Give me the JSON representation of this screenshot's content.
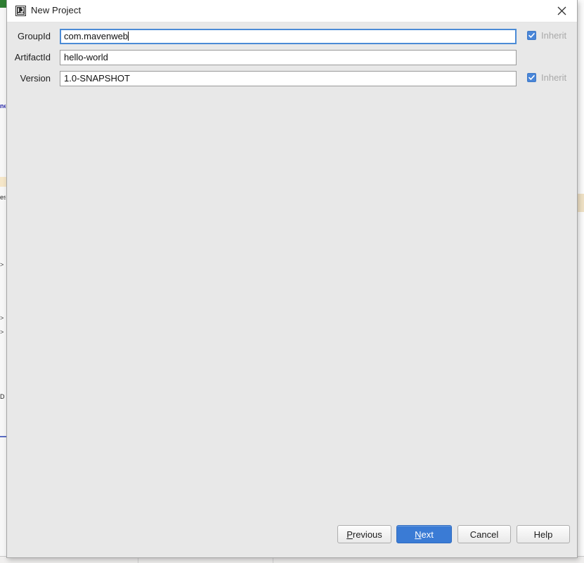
{
  "window": {
    "title": "New Project",
    "icon": "intellij-idea-icon",
    "close_icon": "close-icon"
  },
  "form": {
    "rows": [
      {
        "label": "GroupId",
        "value": "com.mavenweb",
        "focused": true,
        "caret": true,
        "inherit": {
          "label": "Inherit",
          "checked": true,
          "visible": true
        }
      },
      {
        "label": "ArtifactId",
        "value": "hello-world",
        "focused": false,
        "caret": false,
        "inherit": {
          "label": "",
          "checked": false,
          "visible": false
        }
      },
      {
        "label": "Version",
        "value": "1.0-SNAPSHOT",
        "focused": false,
        "caret": false,
        "inherit": {
          "label": "Inherit",
          "checked": true,
          "visible": true
        }
      }
    ]
  },
  "buttons": {
    "previous": {
      "label": "Previous",
      "mnemonic": "P",
      "rest": "revious",
      "primary": false
    },
    "next": {
      "label": "Next",
      "mnemonic": "N",
      "rest": "ext",
      "primary": true
    },
    "cancel": {
      "label": "Cancel",
      "primary": false
    },
    "help": {
      "label": "Help",
      "primary": false
    }
  },
  "colors": {
    "accent": "#3a7bd5",
    "checkbox": "#4a86d8",
    "focus_border": "#4b8bd6",
    "dialog_bg": "#e8e8e8",
    "titlebar_bg": "#ffffff"
  },
  "background": {
    "fragments": [
      "n",
      "ne",
      "es",
      ">",
      ">",
      ">",
      "D"
    ]
  }
}
